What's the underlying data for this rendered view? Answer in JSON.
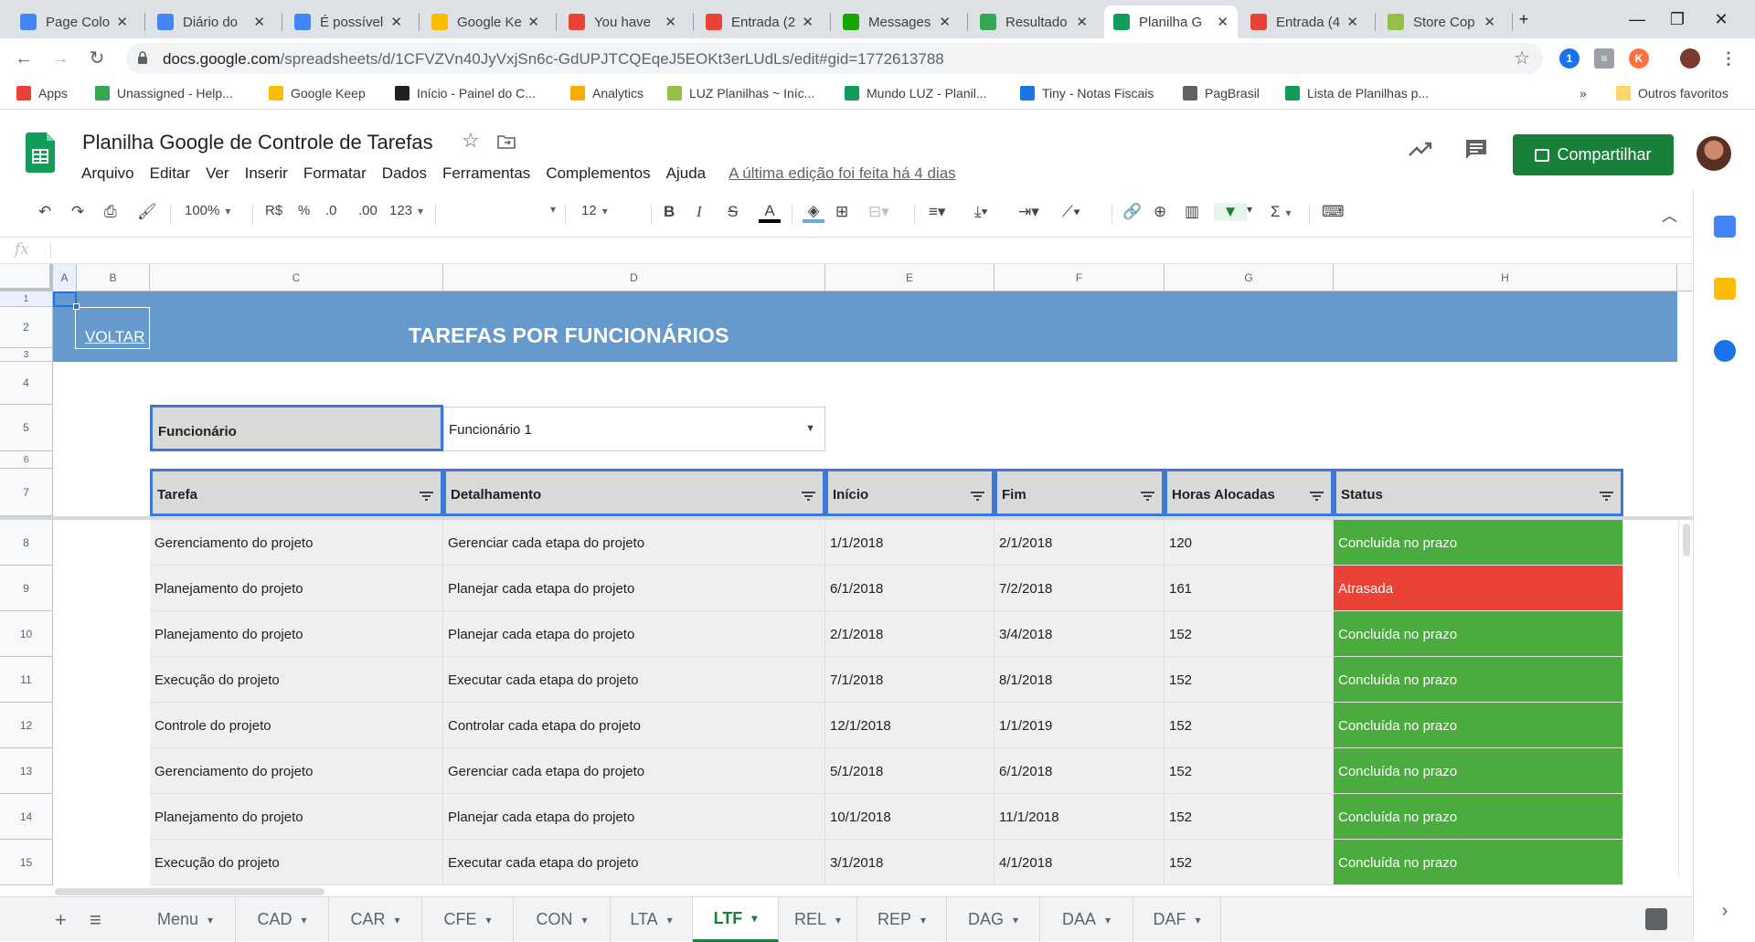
{
  "browser": {
    "tabs": [
      {
        "title": "Page Colo",
        "icon": "docs-icon",
        "color": "#4285f4"
      },
      {
        "title": "Diário do",
        "icon": "docs-icon",
        "color": "#4285f4"
      },
      {
        "title": "É possível",
        "icon": "docs-icon",
        "color": "#4285f4"
      },
      {
        "title": "Google Ke",
        "icon": "keep-icon",
        "color": "#fbbc04"
      },
      {
        "title": "You have",
        "icon": "gmail-icon",
        "color": "#ea4335"
      },
      {
        "title": "Entrada (2",
        "icon": "gmail-icon",
        "color": "#ea4335"
      },
      {
        "title": "Messages",
        "icon": "upwork-icon",
        "color": "#14a800"
      },
      {
        "title": "Resultado",
        "icon": "drive-icon",
        "color": "#34a853"
      },
      {
        "title": "Planilha G",
        "icon": "sheets-icon",
        "color": "#0f9d58"
      },
      {
        "title": "Entrada (4",
        "icon": "gmail-icon",
        "color": "#ea4335"
      },
      {
        "title": "Store Cop",
        "icon": "shopify-icon",
        "color": "#95bf47"
      }
    ],
    "url_host": "docs.google.com",
    "url_path": "/spreadsheets/d/1CFVZVn40JyVxjSn6c-GdUPJTCQEqeJ5EOKt3erLUdLs/edit#gid=1772613788",
    "bookmarks": [
      {
        "label": "Apps",
        "icon": "apps-grid-icon",
        "color": "#ea4335"
      },
      {
        "label": "Unassigned - Help...",
        "icon": "zendesk-icon",
        "color": "#34a853"
      },
      {
        "label": "Google Keep",
        "icon": "keep-icon",
        "color": "#fbbc04"
      },
      {
        "label": "Início - Painel do C...",
        "icon": "bars-icon",
        "color": "#202124"
      },
      {
        "label": "Analytics",
        "icon": "analytics-icon",
        "color": "#f9ab00"
      },
      {
        "label": "LUZ Planilhas ~ Iníc...",
        "icon": "shopify-icon",
        "color": "#95bf47"
      },
      {
        "label": "Mundo LUZ - Planil...",
        "icon": "sheets-icon",
        "color": "#0f9d58"
      },
      {
        "label": "Tiny - Notas Fiscais",
        "icon": "tiny-icon",
        "color": "#1a73e8"
      },
      {
        "label": "PagBrasil",
        "icon": "pagbrasil-icon",
        "color": "#5f6368"
      },
      {
        "label": "Lista de Planilhas p...",
        "icon": "sheets-icon",
        "color": "#0f9d58"
      }
    ],
    "other_bookmarks": "Outros favoritos",
    "overflow": "»"
  },
  "doc": {
    "title": "Planilha Google de Controle de Tarefas",
    "menu": [
      "Arquivo",
      "Editar",
      "Ver",
      "Inserir",
      "Formatar",
      "Dados",
      "Ferramentas",
      "Complementos",
      "Ajuda"
    ],
    "last_edit": "A última edição foi feita há 4 dias",
    "share_label": "Compartilhar"
  },
  "toolbar": {
    "zoom": "100%",
    "currency": "R$",
    "percent": "%",
    "dec_less": ".0",
    "dec_more": ".00",
    "format_more": "123",
    "font_size": "12",
    "bold": "B",
    "italic": "I",
    "strike": "S",
    "text_color": "A",
    "sum": "Σ"
  },
  "formula_bar": {
    "fx": "fx",
    "value": ""
  },
  "columns": [
    "A",
    "B",
    "C",
    "D",
    "E",
    "F",
    "G",
    "H"
  ],
  "row_numbers": [
    "1",
    "2",
    "3",
    "4",
    "5",
    "6",
    "7",
    "8",
    "9",
    "10",
    "11",
    "12",
    "13",
    "14",
    "15"
  ],
  "sheet": {
    "voltar": "VOLTAR",
    "banner_title": "TAREFAS POR FUNCIONÁRIOS",
    "filter_label": "Funcionário",
    "filter_value": "Funcionário 1",
    "headers": [
      "Tarefa",
      "Detalhamento",
      "Início",
      "Fim",
      "Horas Alocadas",
      "Status"
    ],
    "rows": [
      [
        "Gerenciamento do projeto",
        "Gerenciar cada etapa do projeto",
        "1/1/2018",
        "2/1/2018",
        "120",
        "Concluída no prazo"
      ],
      [
        "Planejamento do projeto",
        "Planejar cada etapa do projeto",
        "6/1/2018",
        "7/2/2018",
        "161",
        "Atrasada"
      ],
      [
        "Planejamento do projeto",
        "Planejar cada etapa do projeto",
        "2/1/2018",
        "3/4/2018",
        "152",
        "Concluída no prazo"
      ],
      [
        "Execução do projeto",
        "Executar cada etapa do projeto",
        "7/1/2018",
        "8/1/2018",
        "152",
        "Concluída no prazo"
      ],
      [
        "Controle do projeto",
        "Controlar cada etapa do projeto",
        "12/1/2018",
        "1/1/2019",
        "152",
        "Concluída no prazo"
      ],
      [
        "Gerenciamento do projeto",
        "Gerenciar cada etapa do projeto",
        "5/1/2018",
        "6/1/2018",
        "152",
        "Concluída no prazo"
      ],
      [
        "Planejamento do projeto",
        "Planejar cada etapa do projeto",
        "10/1/2018",
        "11/1/2018",
        "152",
        "Concluída no prazo"
      ],
      [
        "Execução do projeto",
        "Executar cada etapa do projeto",
        "3/1/2018",
        "4/1/2018",
        "152",
        "Concluída no prazo"
      ]
    ],
    "status_colors": {
      "Concluída no prazo": "#4aab3e",
      "Atrasada": "#ea4335"
    }
  },
  "sheet_tabs": [
    "Menu",
    "CAD",
    "CAR",
    "CFE",
    "CON",
    "LTA",
    "LTF",
    "REL",
    "REP",
    "DAG",
    "DAA",
    "DAF"
  ],
  "active_sheet_tab": "LTF"
}
